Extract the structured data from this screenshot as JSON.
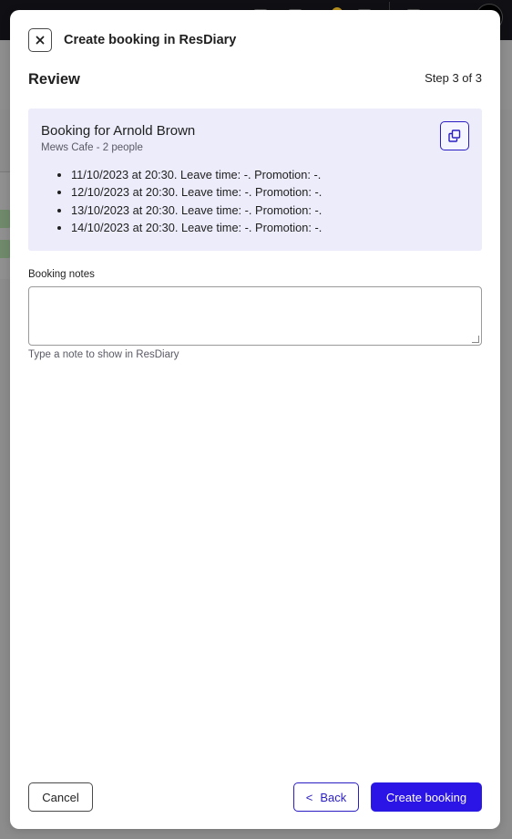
{
  "modal": {
    "title": "Create booking in ResDiary",
    "close_icon": "close-icon",
    "heading": "Review",
    "step": "Step 3 of 3"
  },
  "summary": {
    "title": "Booking for Arnold Brown",
    "subtitle": "Mews Cafe - 2 people",
    "copy_icon": "copy-icon",
    "bookings": [
      "11/10/2023 at 20:30. Leave time: -. Promotion: -.",
      "12/10/2023 at 20:30. Leave time: -. Promotion: -.",
      "13/10/2023 at 20:30. Leave time: -. Promotion: -.",
      "14/10/2023 at 20:30. Leave time: -. Promotion: -."
    ]
  },
  "notes": {
    "label": "Booking notes",
    "value": "",
    "hint": "Type a note to show in ResDiary"
  },
  "footer": {
    "cancel_label": "Cancel",
    "back_chevron": "<",
    "back_label": "Back",
    "create_label": "Create booking"
  },
  "colors": {
    "accent": "#2a14e6",
    "card_background": "#ececfa",
    "overlay": "#8a8a8a"
  }
}
